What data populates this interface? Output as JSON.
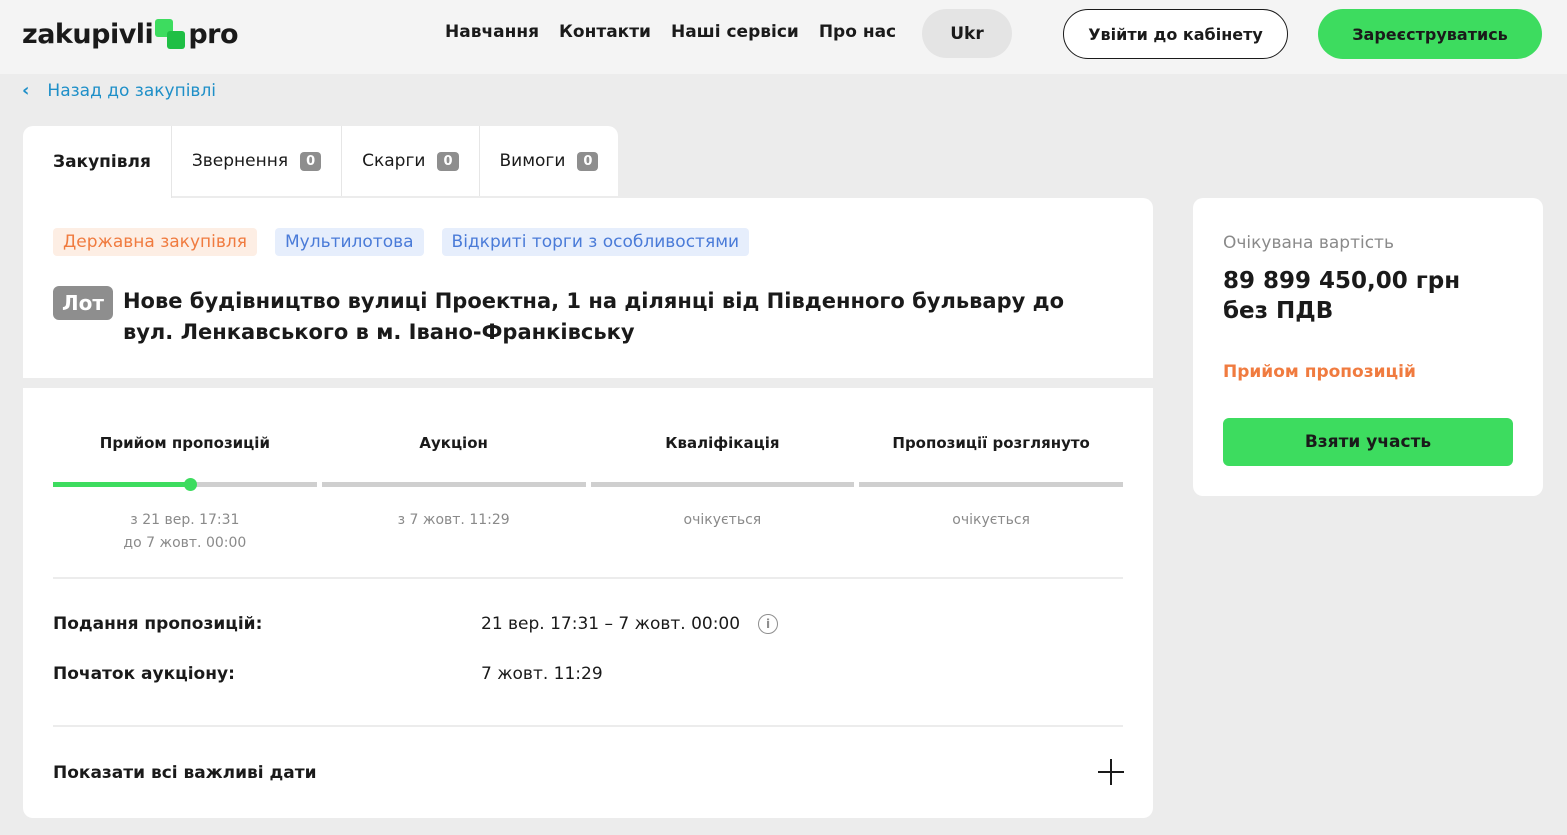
{
  "header": {
    "logo_left": "zakupivli",
    "logo_right": "pro",
    "nav": [
      "Навчання",
      "Контакти",
      "Наші сервіси",
      "Про нас"
    ],
    "language": "Ukr",
    "login_label": "Увійти до кабінету",
    "register_label": "Зареєструватись"
  },
  "back_link": "Назад до закупівлі",
  "tabs": [
    {
      "label": "Закупівля"
    },
    {
      "label": "Звернення",
      "count": "0"
    },
    {
      "label": "Скарги",
      "count": "0"
    },
    {
      "label": "Вимоги",
      "count": "0"
    }
  ],
  "badges": [
    "Державна закупівля",
    "Мультилотова",
    "Відкриті торги з особливостями"
  ],
  "lot": {
    "label": "Лот",
    "title": "Нове будівництво вулиці Проектна, 1 на ділянці від Південного бульвару до вул. Ленкавського в м. Івано-Франківську"
  },
  "stages": [
    {
      "title": "Прийом пропозицій",
      "date_line1": "з 21 вер. 17:31",
      "date_line2": "до 7 жовт. 00:00",
      "progress": 0.52
    },
    {
      "title": "Аукціон",
      "date_line1": "з 7 жовт. 11:29",
      "date_line2": "",
      "progress": 0
    },
    {
      "title": "Кваліфікація",
      "date_line1": "очікується",
      "date_line2": "",
      "progress": 0
    },
    {
      "title": "Пропозиції розглянуто",
      "date_line1": "очікується",
      "date_line2": "",
      "progress": 0
    }
  ],
  "info": {
    "submission_label": "Подання пропозицій:",
    "submission_value": "21 вер. 17:31 – 7 жовт. 00:00",
    "auction_label": "Початок аукціону:",
    "auction_value": "7 жовт. 11:29"
  },
  "show_dates_label": "Показати всі важливі дати",
  "side": {
    "expected_label": "Очікувана вартість",
    "amount": "89 899 450,00 грн без ПДВ",
    "status": "Прийом пропозицій",
    "take_part_label": "Взяти участь"
  },
  "colors": {
    "accent_green": "#3ddc5f",
    "status_orange": "#f07b3f",
    "link_blue": "#1e8fc8"
  }
}
